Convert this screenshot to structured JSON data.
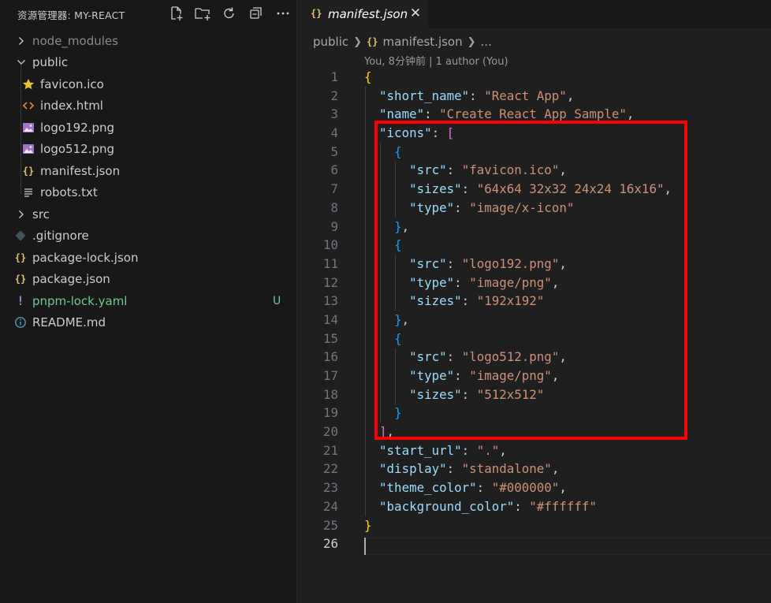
{
  "sidebar": {
    "title": "资源管理器: MY-REACT",
    "actions": [
      {
        "name": "new-file-icon"
      },
      {
        "name": "new-folder-icon"
      },
      {
        "name": "refresh-icon"
      },
      {
        "name": "collapse-all-icon"
      },
      {
        "name": "more-icon"
      }
    ],
    "tree": [
      {
        "label": "node_modules",
        "type": "folder",
        "expanded": false,
        "depth": 0,
        "dim": true
      },
      {
        "label": "public",
        "type": "folder",
        "expanded": true,
        "depth": 0
      },
      {
        "label": "favicon.ico",
        "type": "file",
        "icon": "star",
        "depth": 1
      },
      {
        "label": "index.html",
        "type": "file",
        "icon": "html",
        "depth": 1
      },
      {
        "label": "logo192.png",
        "type": "file",
        "icon": "image",
        "depth": 1
      },
      {
        "label": "logo512.png",
        "type": "file",
        "icon": "image",
        "depth": 1
      },
      {
        "label": "manifest.json",
        "type": "file",
        "icon": "json",
        "depth": 1
      },
      {
        "label": "robots.txt",
        "type": "file",
        "icon": "text",
        "depth": 1
      },
      {
        "label": "src",
        "type": "folder",
        "expanded": false,
        "depth": 0
      },
      {
        "label": ".gitignore",
        "type": "file",
        "icon": "git",
        "depth": 0
      },
      {
        "label": "package-lock.json",
        "type": "file",
        "icon": "json",
        "depth": 0
      },
      {
        "label": "package.json",
        "type": "file",
        "icon": "json",
        "depth": 0
      },
      {
        "label": "pnpm-lock.yaml",
        "type": "file",
        "icon": "yaml",
        "depth": 0,
        "badge": "U",
        "untracked": true
      },
      {
        "label": "README.md",
        "type": "file",
        "icon": "info",
        "depth": 0
      }
    ]
  },
  "editor": {
    "tab": {
      "icon": "{}",
      "label": "manifest.json",
      "close": "✕"
    },
    "breadcrumb": {
      "folder": "public",
      "icon": "{}",
      "file": "manifest.json",
      "more": "..."
    },
    "blame": "You, 8分钟前 | 1 author (You)",
    "active_line": 26,
    "lines": [
      "{",
      "  \"short_name\": \"React App\",",
      "  \"name\": \"Create React App Sample\",",
      "  \"icons\": [",
      "    {",
      "      \"src\": \"favicon.ico\",",
      "      \"sizes\": \"64x64 32x32 24x24 16x16\",",
      "      \"type\": \"image/x-icon\"",
      "    },",
      "    {",
      "      \"src\": \"logo192.png\",",
      "      \"type\": \"image/png\",",
      "      \"sizes\": \"192x192\"",
      "    },",
      "    {",
      "      \"src\": \"logo512.png\",",
      "      \"type\": \"image/png\",",
      "      \"sizes\": \"512x512\"",
      "    }",
      "  ],",
      "  \"start_url\": \".\",",
      "  \"display\": \"standalone\",",
      "  \"theme_color\": \"#000000\",",
      "  \"background_color\": \"#ffffff\"",
      "}",
      ""
    ]
  },
  "annotation": {
    "color": "#ff0000",
    "covers_lines": "4-20"
  },
  "colors": {
    "sidebar_bg": "#181818",
    "editor_bg": "#1f1f1f",
    "json_key": "#9cdcfe",
    "json_string": "#ce9178",
    "bracket_gold": "#ffd700",
    "bracket_orchid": "#da70d6",
    "bracket_blue": "#179fff",
    "untracked_green": "#73c991"
  }
}
